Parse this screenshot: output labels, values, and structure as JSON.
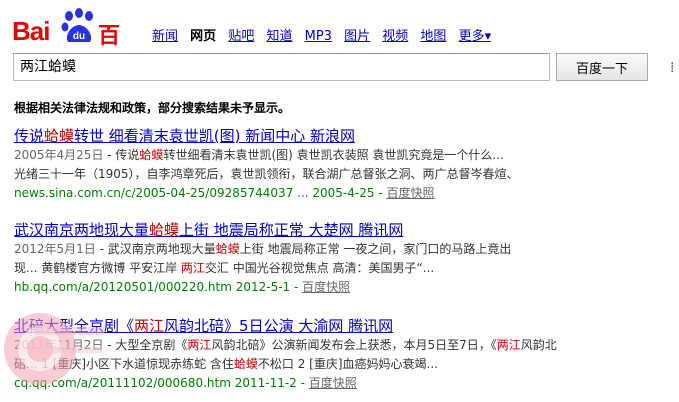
{
  "logo": {
    "latin": "Bai",
    "paw_text": "du",
    "chinese": "百度"
  },
  "nav": {
    "items": [
      "新闻",
      "网页",
      "贴吧",
      "知道",
      "MP3",
      "图片",
      "视频",
      "地图"
    ],
    "active_index": 1,
    "more": "更多▾"
  },
  "search": {
    "query": "两江蛤蟆",
    "button": "百度一下"
  },
  "edge_mark": "⁞",
  "notice": "根据相关法律法规和政策，部分搜索结果未予显示。",
  "results": [
    {
      "title": [
        {
          "t": "传说"
        },
        {
          "t": "蛤蟆",
          "hl": true
        },
        {
          "t": "转世 细看清末袁世凯(图) 新闻中心 新浪网"
        }
      ],
      "line1": [
        {
          "t": "2005年4月25日",
          "date": true
        },
        {
          "t": " - 传说"
        },
        {
          "t": "蛤蟆",
          "hl": true
        },
        {
          "t": "转世细看清末袁世凯(图) 袁世凯衣装照 袁世凯究竟是一个什么..."
        }
      ],
      "line2": [
        {
          "t": "光绪三十一年（1905），自李鸿章死后，袁世凯领衔，联合湖广总督张之洞、两广总督岑春煊、"
        }
      ],
      "url": "news.sina.com.cn/c/2005-04-25/09285744037 ... 2005-4-25",
      "snapshot": "百度快照"
    },
    {
      "title": [
        {
          "t": "武汉南京两地现大量"
        },
        {
          "t": "蛤蟆",
          "hl": true
        },
        {
          "t": "上街 地震局称正常 大楚网 腾讯网"
        }
      ],
      "line1": [
        {
          "t": "2012年5月1日",
          "date": true
        },
        {
          "t": " - 武汉南京两地现大量"
        },
        {
          "t": "蛤蟆",
          "hl": true
        },
        {
          "t": "上街 地震局称正常 一夜之间，家门口的马路上竟出"
        }
      ],
      "line2": [
        {
          "t": "现... 黄鹤楼官方微博 平安江岸 "
        },
        {
          "t": "两江",
          "hl": true
        },
        {
          "t": "交汇 中国光谷视觉焦点 高清：美国男子“..."
        }
      ],
      "url": "hb.qq.com/a/20120501/000220.htm 2012-5-1",
      "snapshot": "百度快照"
    },
    {
      "title": [
        {
          "t": "北碚大型全京剧《"
        },
        {
          "t": "两江",
          "hl": true
        },
        {
          "t": "风韵北碚》5日公演 大渝网 腾讯网"
        }
      ],
      "line1": [
        {
          "t": "2011年11月2日",
          "date": true
        },
        {
          "t": " - 大型全京剧《"
        },
        {
          "t": "两江",
          "hl": true
        },
        {
          "t": "风韵北碚》公演新闻发布会上获悉，本月5日至7日，《"
        },
        {
          "t": "两江",
          "hl": true
        },
        {
          "t": "风韵北"
        }
      ],
      "line2": [
        {
          "t": "碚... 1 [重庆]小区下水道惊现赤练蛇 含住"
        },
        {
          "t": "蛤蟆",
          "hl": true
        },
        {
          "t": "不松口 2 [重庆]血癌妈妈心衰竭..."
        }
      ],
      "url": "cq.qq.com/a/20111102/000680.htm 2011-11-2",
      "snapshot": "百度快照"
    }
  ],
  "colors": {
    "brand_red": "#e10602",
    "link": "#0000cc",
    "url_green": "#008000",
    "highlight": "#cc0000"
  }
}
